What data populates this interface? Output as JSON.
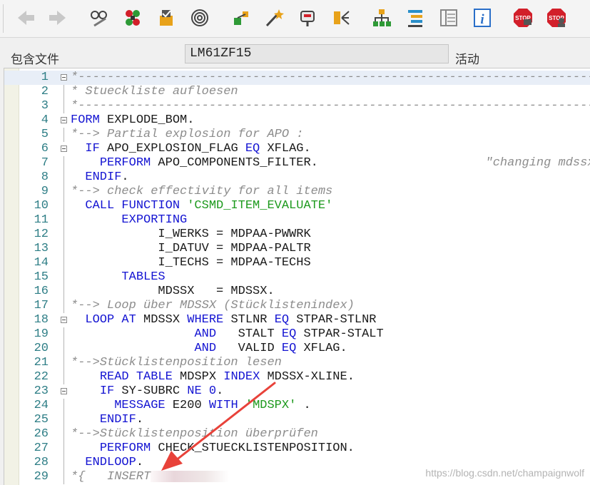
{
  "toolbar": {
    "buttons": [
      {
        "name": "back-icon",
        "label": "Back"
      },
      {
        "name": "forward-icon",
        "label": "Forward"
      },
      {
        "name": "display-change-icon",
        "label": "Display/Change"
      },
      {
        "name": "activate-icon",
        "label": "Activate"
      },
      {
        "name": "check-icon",
        "label": "Check"
      },
      {
        "name": "other-object-icon",
        "label": "Other object"
      },
      {
        "name": "where-used-icon",
        "label": "Where-used list"
      },
      {
        "name": "magic-wand-icon",
        "label": "Pattern"
      },
      {
        "name": "breakpoint-icon",
        "label": "Breakpoint"
      },
      {
        "name": "navigate-icon",
        "label": "Navigate"
      },
      {
        "name": "hierarchy-icon",
        "label": "Object list"
      },
      {
        "name": "pretty-printer-icon",
        "label": "Pretty printer"
      },
      {
        "name": "layout-icon",
        "label": "Layout"
      },
      {
        "name": "info-icon",
        "label": "i"
      },
      {
        "name": "stop-monitor-icon",
        "label": "STOP"
      },
      {
        "name": "stop-user-icon",
        "label": "STOP"
      }
    ]
  },
  "info": {
    "include_label": "包含文件",
    "include_value": "LM61ZF15",
    "status": "活动"
  },
  "code_lines": [
    {
      "no": "1",
      "fold": true,
      "hl": true,
      "tokens": [
        {
          "t": "cm",
          "v": "*-----------------------------------------------------------------------*"
        }
      ]
    },
    {
      "no": "2",
      "tokens": [
        {
          "t": "cm",
          "v": "* Stueckliste aufloesen                                                  *"
        }
      ]
    },
    {
      "no": "3",
      "tokens": [
        {
          "t": "cm",
          "v": "*-----------------------------------------------------------------------*"
        }
      ]
    },
    {
      "no": "4",
      "fold": true,
      "tokens": [
        {
          "t": "kw",
          "v": "FORM"
        },
        {
          "t": "tx",
          "v": " EXPLODE_BOM."
        }
      ]
    },
    {
      "no": "5",
      "tokens": [
        {
          "t": "cm",
          "v": "*--> Partial explosion for APO :"
        }
      ]
    },
    {
      "no": "6",
      "fold": true,
      "tokens": [
        {
          "t": "tx",
          "v": "  "
        },
        {
          "t": "kw",
          "v": "IF"
        },
        {
          "t": "tx",
          "v": " APO_EXPLOSION_FLAG "
        },
        {
          "t": "kw",
          "v": "EQ"
        },
        {
          "t": "tx",
          "v": " XFLAG."
        }
      ]
    },
    {
      "no": "7",
      "tokens": [
        {
          "t": "tx",
          "v": "    "
        },
        {
          "t": "kw",
          "v": "PERFORM"
        },
        {
          "t": "tx",
          "v": " APO_COMPONENTS_FILTER.                       "
        },
        {
          "t": "cm",
          "v": "\"changing mdssx"
        }
      ]
    },
    {
      "no": "8",
      "tokens": [
        {
          "t": "tx",
          "v": "  "
        },
        {
          "t": "kw",
          "v": "ENDIF"
        },
        {
          "t": "tx",
          "v": "."
        }
      ]
    },
    {
      "no": "9",
      "tokens": [
        {
          "t": "cm",
          "v": "*--> check effectivity for all items"
        }
      ]
    },
    {
      "no": "10",
      "tokens": [
        {
          "t": "tx",
          "v": "  "
        },
        {
          "t": "kw",
          "v": "CALL FUNCTION"
        },
        {
          "t": "tx",
          "v": " "
        },
        {
          "t": "st",
          "v": "'CSMD_ITEM_EVALUATE'"
        }
      ]
    },
    {
      "no": "11",
      "tokens": [
        {
          "t": "tx",
          "v": "       "
        },
        {
          "t": "kw",
          "v": "EXPORTING"
        }
      ]
    },
    {
      "no": "12",
      "tokens": [
        {
          "t": "tx",
          "v": "            I_WERKS = MDPAA-PWWRK"
        }
      ]
    },
    {
      "no": "13",
      "tokens": [
        {
          "t": "tx",
          "v": "            I_DATUV = MDPAA-PALTR"
        }
      ]
    },
    {
      "no": "14",
      "tokens": [
        {
          "t": "tx",
          "v": "            I_TECHS = MDPAA-TECHS"
        }
      ]
    },
    {
      "no": "15",
      "tokens": [
        {
          "t": "tx",
          "v": "       "
        },
        {
          "t": "kw",
          "v": "TABLES"
        }
      ]
    },
    {
      "no": "16",
      "tokens": [
        {
          "t": "tx",
          "v": "            MDSSX   = MDSSX."
        }
      ]
    },
    {
      "no": "17",
      "tokens": [
        {
          "t": "cm",
          "v": "*--> Loop über MDSSX (Stücklistenindex)"
        }
      ]
    },
    {
      "no": "18",
      "fold": true,
      "tokens": [
        {
          "t": "tx",
          "v": "  "
        },
        {
          "t": "kw",
          "v": "LOOP AT"
        },
        {
          "t": "tx",
          "v": " MDSSX "
        },
        {
          "t": "kw",
          "v": "WHERE"
        },
        {
          "t": "tx",
          "v": " STLNR "
        },
        {
          "t": "kw",
          "v": "EQ"
        },
        {
          "t": "tx",
          "v": " STPAR-STLNR"
        }
      ]
    },
    {
      "no": "19",
      "tokens": [
        {
          "t": "tx",
          "v": "                 "
        },
        {
          "t": "kw",
          "v": "AND"
        },
        {
          "t": "tx",
          "v": "   STALT "
        },
        {
          "t": "kw",
          "v": "EQ"
        },
        {
          "t": "tx",
          "v": " STPAR-STALT"
        }
      ]
    },
    {
      "no": "20",
      "tokens": [
        {
          "t": "tx",
          "v": "                 "
        },
        {
          "t": "kw",
          "v": "AND"
        },
        {
          "t": "tx",
          "v": "   VALID "
        },
        {
          "t": "kw",
          "v": "EQ"
        },
        {
          "t": "tx",
          "v": " XFLAG."
        }
      ]
    },
    {
      "no": "21",
      "tokens": [
        {
          "t": "cm",
          "v": "*-->Stücklistenposition lesen"
        }
      ]
    },
    {
      "no": "22",
      "tokens": [
        {
          "t": "tx",
          "v": "    "
        },
        {
          "t": "kw",
          "v": "READ TABLE"
        },
        {
          "t": "tx",
          "v": " MDSPX "
        },
        {
          "t": "kw",
          "v": "INDEX"
        },
        {
          "t": "tx",
          "v": " MDSSX-XLINE."
        }
      ]
    },
    {
      "no": "23",
      "fold": true,
      "tokens": [
        {
          "t": "tx",
          "v": "    "
        },
        {
          "t": "kw",
          "v": "IF"
        },
        {
          "t": "tx",
          "v": " SY-SUBRC "
        },
        {
          "t": "kw",
          "v": "NE"
        },
        {
          "t": "tx",
          "v": " "
        },
        {
          "t": "num",
          "v": "0"
        },
        {
          "t": "tx",
          "v": "."
        }
      ]
    },
    {
      "no": "24",
      "tokens": [
        {
          "t": "tx",
          "v": "      "
        },
        {
          "t": "kw",
          "v": "MESSAGE"
        },
        {
          "t": "tx",
          "v": " E200 "
        },
        {
          "t": "kw",
          "v": "WITH"
        },
        {
          "t": "tx",
          "v": " "
        },
        {
          "t": "st",
          "v": "'MDSPX'"
        },
        {
          "t": "tx",
          "v": " ."
        }
      ]
    },
    {
      "no": "25",
      "tokens": [
        {
          "t": "tx",
          "v": "    "
        },
        {
          "t": "kw",
          "v": "ENDIF"
        },
        {
          "t": "tx",
          "v": "."
        }
      ]
    },
    {
      "no": "26",
      "tokens": [
        {
          "t": "cm",
          "v": "*-->Stücklistenposition überprüfen"
        }
      ]
    },
    {
      "no": "27",
      "tokens": [
        {
          "t": "tx",
          "v": "    "
        },
        {
          "t": "kw",
          "v": "PERFORM"
        },
        {
          "t": "tx",
          "v": " CHECK_STUECKLISTENPOSITION."
        }
      ]
    },
    {
      "no": "28",
      "tokens": [
        {
          "t": "tx",
          "v": "  "
        },
        {
          "t": "kw",
          "v": "ENDLOOP"
        },
        {
          "t": "tx",
          "v": "."
        }
      ]
    },
    {
      "no": "29",
      "tokens": [
        {
          "t": "cm",
          "v": "*{   INSERT"
        },
        {
          "t": "blur",
          "v": ""
        }
      ]
    }
  ],
  "watermark": "https://blog.csdn.net/champaignwolf"
}
